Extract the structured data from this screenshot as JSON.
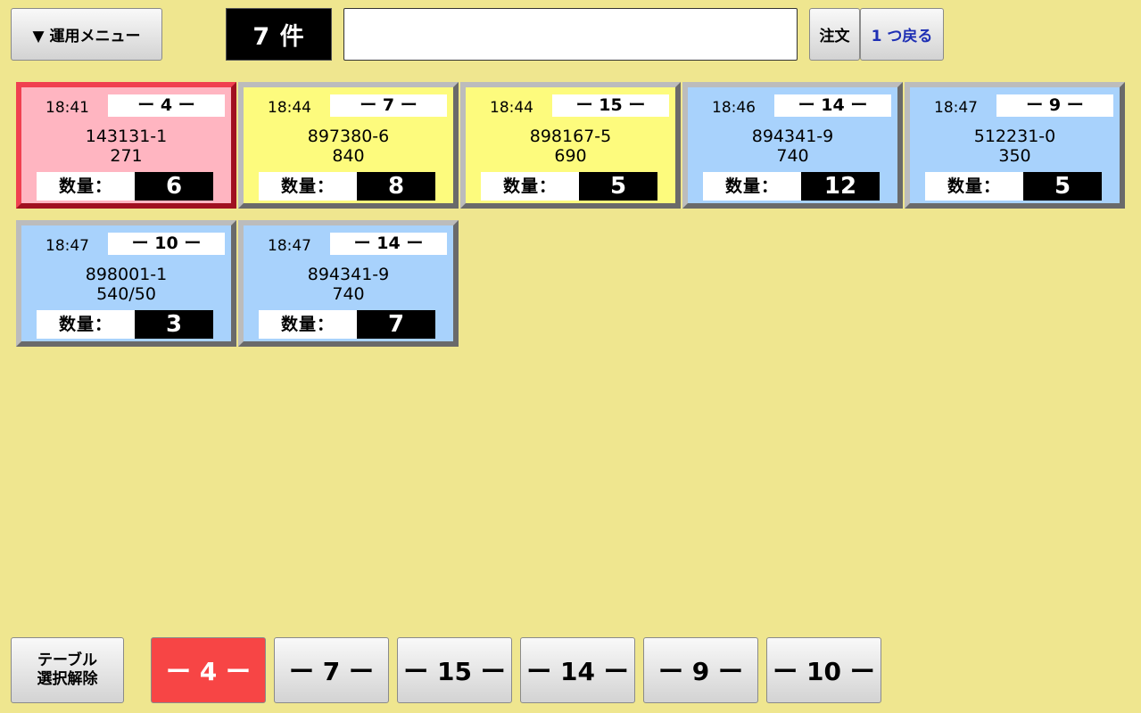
{
  "header": {
    "menu_label": "▼ 運用メニュー",
    "count_label": "7 件",
    "search_value": "",
    "order_label": "注文",
    "back_label": "1 つ戻る"
  },
  "cards": [
    {
      "time": "18:41",
      "table": "ー 4 ー",
      "code": "143131-1",
      "value": "271",
      "qty_label": "数量：",
      "qty": "6",
      "color": "pink",
      "selected": true
    },
    {
      "time": "18:44",
      "table": "ー 7 ー",
      "code": "897380-6",
      "value": "840",
      "qty_label": "数量：",
      "qty": "8",
      "color": "yellow",
      "selected": false
    },
    {
      "time": "18:44",
      "table": "ー 15 ー",
      "code": "898167-5",
      "value": "690",
      "qty_label": "数量：",
      "qty": "5",
      "color": "yellow",
      "selected": false
    },
    {
      "time": "18:46",
      "table": "ー 14 ー",
      "code": "894341-9",
      "value": "740",
      "qty_label": "数量：",
      "qty": "12",
      "color": "blue",
      "selected": false
    },
    {
      "time": "18:47",
      "table": "ー 9 ー",
      "code": "512231-0",
      "value": "350",
      "qty_label": "数量：",
      "qty": "5",
      "color": "blue",
      "selected": false
    },
    {
      "time": "18:47",
      "table": "ー 10 ー",
      "code": "898001-1",
      "value": "540/50",
      "qty_label": "数量：",
      "qty": "3",
      "color": "blue",
      "selected": false
    },
    {
      "time": "18:47",
      "table": "ー 14 ー",
      "code": "894341-9",
      "value": "740",
      "qty_label": "数量：",
      "qty": "7",
      "color": "blue",
      "selected": false
    }
  ],
  "footer": {
    "clear_line1": "テーブル",
    "clear_line2": "選択解除",
    "tables": [
      {
        "label": "ー 4 ー",
        "active": true
      },
      {
        "label": "ー 7 ー",
        "active": false
      },
      {
        "label": "ー 15 ー",
        "active": false
      },
      {
        "label": "ー 14 ー",
        "active": false
      },
      {
        "label": "ー 9 ー",
        "active": false
      },
      {
        "label": "ー 10 ー",
        "active": false
      }
    ]
  },
  "colors": {
    "background": "#efe68f",
    "card_pink": "#ffb5c1",
    "card_yellow": "#fdfb7d",
    "card_blue": "#a8d2fc",
    "active_table": "#f74545",
    "back_text": "#1e2fb4"
  }
}
